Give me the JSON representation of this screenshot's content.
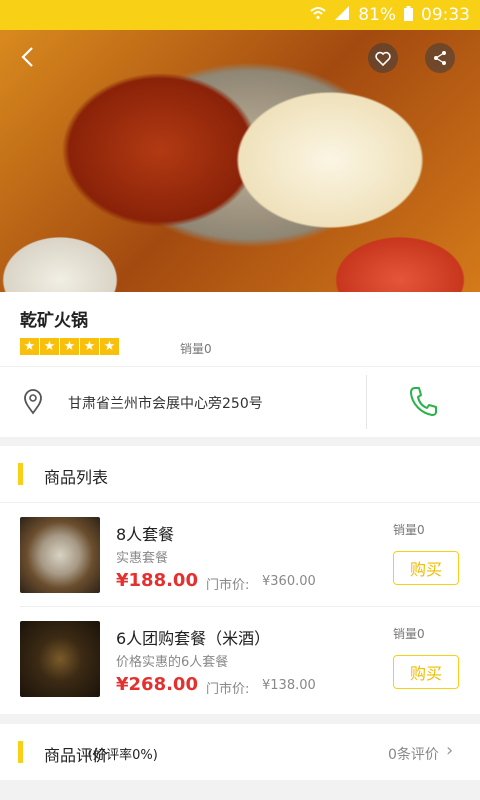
{
  "status_bar": {
    "battery": "81%",
    "time": "09:33"
  },
  "shop": {
    "name": "乾矿火锅",
    "rating_stars": 5,
    "sales": "销量0",
    "address": "甘肃省兰州市会展中心旁250号"
  },
  "products_section": {
    "title": "商品列表"
  },
  "products": [
    {
      "name": "8人套餐",
      "desc": "实惠套餐",
      "price": "¥188.00",
      "market_label": "门市价:",
      "market_price": "¥360.00",
      "sales": "销量0",
      "buy": "购买"
    },
    {
      "name": "6人团购套餐（米酒）",
      "desc": "价格实惠的6人套餐",
      "price": "¥268.00",
      "market_label": "门市价:",
      "market_price": "¥138.00",
      "sales": "销量0",
      "buy": "购买"
    }
  ],
  "reviews_section": {
    "title": "商品评价",
    "rate": "(好评率0%)",
    "count": "0条评价"
  },
  "icons": [
    "wifi-icon",
    "signal-icon",
    "battery-icon",
    "back-icon",
    "heart-icon",
    "share-icon",
    "location-pin-icon",
    "phone-icon",
    "chevron-right-icon"
  ],
  "colors": {
    "accent": "#f8d016",
    "price": "#e53030",
    "phone_green": "#2bb34a"
  }
}
